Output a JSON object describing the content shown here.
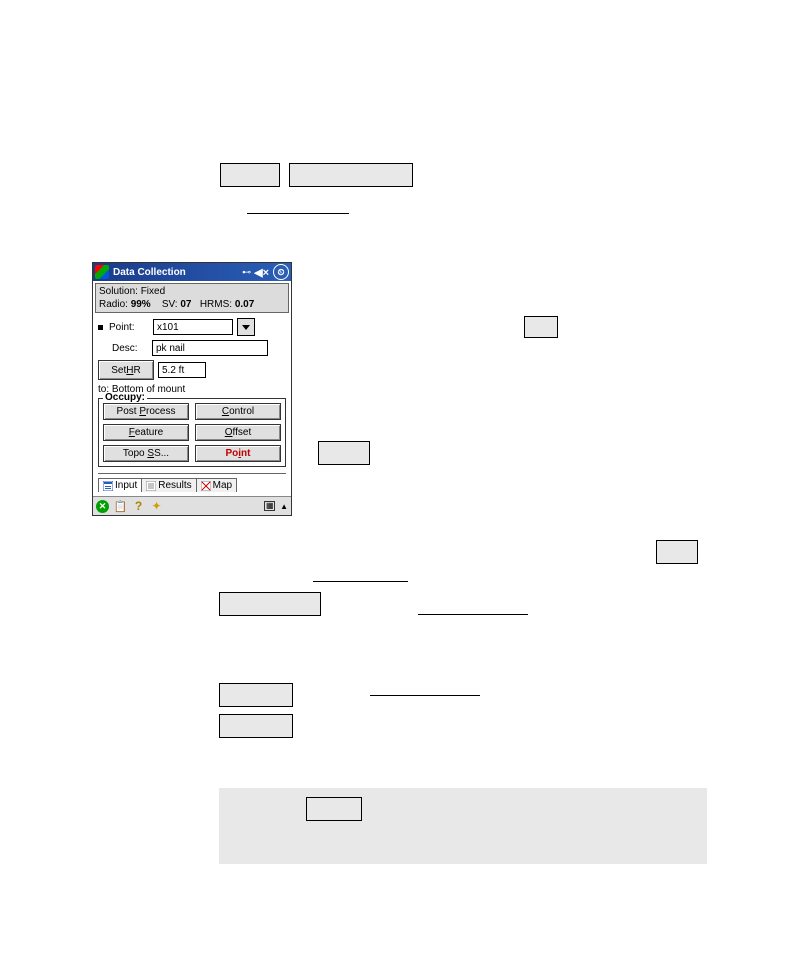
{
  "pda": {
    "title": "Data Collection",
    "status": {
      "solution_label": "Solution:",
      "solution_value": "Fixed",
      "radio_label": "Radio:",
      "radio_value": "99%",
      "sv_label": "SV:",
      "sv_value": "07",
      "hrms_label": "HRMS:",
      "hrms_value": "0.07"
    },
    "point_label": "Point:",
    "point_value": "x101",
    "desc_label": "Desc:",
    "desc_value": "pk nail",
    "set_hr_label": "Set HR",
    "hr_value": "5.2 ft",
    "to_text": "to: Bottom of mount",
    "occupy_legend": "Occupy:",
    "buttons": {
      "post_process": "Post Process",
      "control": "Control",
      "feature": "Feature",
      "offset": "Offset",
      "topo_ss": "Topo SS...",
      "point": "Point"
    },
    "tabs": {
      "input": "Input",
      "results": "Results",
      "map": "Map"
    }
  }
}
